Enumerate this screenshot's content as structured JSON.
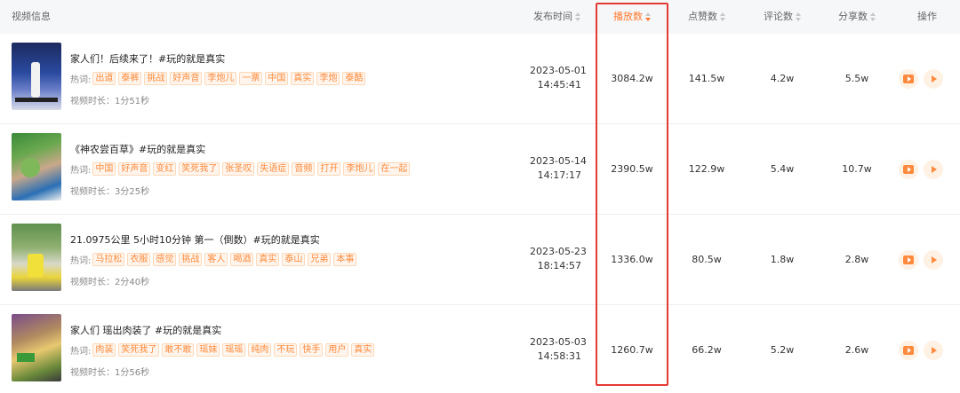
{
  "header": {
    "video_info": "视频信息",
    "publish_time": "发布时间",
    "plays": "播放数",
    "likes": "点赞数",
    "comments": "评论数",
    "shares": "分享数",
    "actions": "操作"
  },
  "hot_label": "热词:",
  "colors": {
    "accent": "#ff7a2e",
    "highlight_box": "#e53935",
    "tag_text": "#ff8a3d"
  },
  "rows": [
    {
      "title": "家人们！后续来了！#玩的就是真实",
      "tags": [
        "出道",
        "泰裤",
        "挑战",
        "好声音",
        "李炮儿",
        "一票",
        "中国",
        "真实",
        "李炮",
        "泰酷"
      ],
      "duration": "视频时长：1分51秒",
      "date": "2023-05-01",
      "time": "14:45:41",
      "plays": "3084.2w",
      "likes": "141.5w",
      "comments": "4.2w",
      "shares": "5.5w"
    },
    {
      "title": "《神农尝百草》#玩的就是真实",
      "tags": [
        "中国",
        "好声音",
        "变红",
        "笑死我了",
        "张圣叹",
        "失语症",
        "音频",
        "打开",
        "李炮儿",
        "在一起"
      ],
      "duration": "视频时长：3分25秒",
      "date": "2023-05-14",
      "time": "14:17:17",
      "plays": "2390.5w",
      "likes": "122.9w",
      "comments": "5.4w",
      "shares": "10.7w"
    },
    {
      "title": "21.0975公里 5小时10分钟 第一（倒数）#玩的就是真实",
      "tags": [
        "马拉松",
        "衣服",
        "感觉",
        "挑战",
        "客人",
        "喝酒",
        "真实",
        "泰山",
        "兄弟",
        "本事"
      ],
      "duration": "视频时长：2分40秒",
      "date": "2023-05-23",
      "time": "18:14:57",
      "plays": "1336.0w",
      "likes": "80.5w",
      "comments": "1.8w",
      "shares": "2.8w"
    },
    {
      "title": "家人们 瑶出肉装了 #玩的就是真实",
      "tags": [
        "肉装",
        "笑死我了",
        "敢不敢",
        "瑶妹",
        "瑶瑶",
        "纯肉",
        "不玩",
        "快手",
        "用户",
        "真实"
      ],
      "duration": "视频时长：1分56秒",
      "date": "2023-05-03",
      "time": "14:58:31",
      "plays": "1260.7w",
      "likes": "66.2w",
      "comments": "5.2w",
      "shares": "2.6w"
    }
  ]
}
